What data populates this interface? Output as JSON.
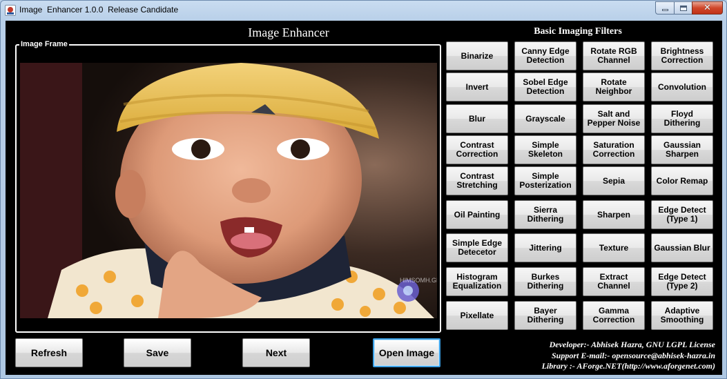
{
  "window": {
    "title": "Image  Enhancer 1.0.0  Release Candidate",
    "close_glyph": "✕"
  },
  "header": {
    "main_title": "Image Enhancer",
    "filters_title": "Basic Imaging Filters"
  },
  "frame": {
    "label": "Image Frame",
    "watermark": "HIMSOMH.GR"
  },
  "bottom_buttons": {
    "refresh": "Refresh",
    "save": "Save",
    "next": "Next",
    "open_image": "Open Image"
  },
  "filters": [
    [
      "Binarize",
      "Canny Edge Detection",
      "Rotate RGB Channel",
      "Brightness Correction"
    ],
    [
      "Invert",
      "Sobel Edge Detection",
      "Rotate Neighbor",
      "Convolution"
    ],
    [
      "Blur",
      "Grayscale",
      "Salt and Pepper Noise",
      "Floyd Dithering"
    ],
    [
      "Contrast Correction",
      "Simple Skeleton",
      "Saturation Correction",
      "Gaussian Sharpen"
    ],
    [
      "Contrast Stretching",
      "Simple Posterization",
      "Sepia",
      "Color Remap"
    ],
    [
      "Oil Painting",
      "Sierra Dithering",
      "Sharpen",
      "Edge Detect (Type 1)"
    ],
    [
      "Simple Edge Detecetor",
      "Jittering",
      "Texture",
      "Gaussian Blur"
    ],
    [
      "Histogram Equalization",
      "Burkes Dithering",
      "Extract Channel",
      "Edge Detect (Type 2)"
    ],
    [
      "Pixellate",
      "Bayer Dithering",
      "Gamma Correction",
      "Adaptive Smoothing"
    ]
  ],
  "credits": {
    "developer": "Developer:- Abhisek Hazra, GNU LGPL License",
    "support": "Support E-mail:- opensource@abhisek-hazra.in",
    "library": "Library :- AForge.NET(http://www.aforgenet.com)"
  }
}
